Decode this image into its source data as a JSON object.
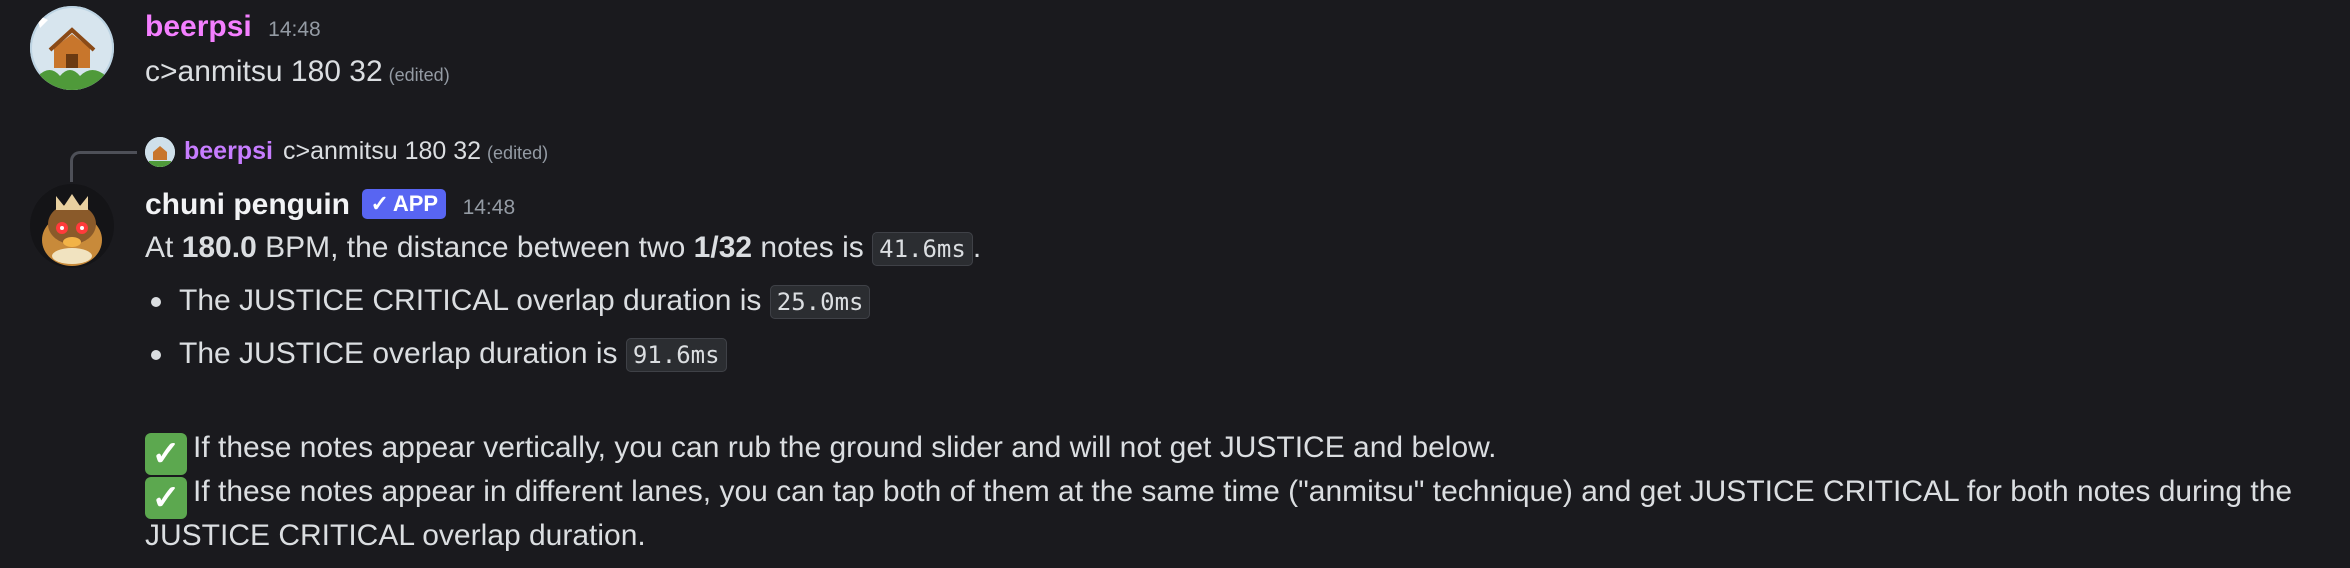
{
  "message1": {
    "username": "beerpsi",
    "username_color": "#f47fff",
    "timestamp": "14:48",
    "content": "c>anmitsu 180 32",
    "edited": "(edited)"
  },
  "reply": {
    "username": "beerpsi",
    "username_color": "#c77dff",
    "content": "c>anmitsu 180 32",
    "edited": "(edited)"
  },
  "message2": {
    "username": "chuni penguin",
    "badge_check": "✓",
    "badge": "APP",
    "timestamp": "14:48",
    "line1": {
      "t1": "At ",
      "bpm": "180.0",
      "t2": " BPM, the distance between two ",
      "division": "1/32",
      "t3": " notes is ",
      "distance": "41.6ms",
      "t4": "."
    },
    "bullets": [
      {
        "text": "The JUSTICE CRITICAL overlap duration is ",
        "value": "25.0ms"
      },
      {
        "text": "The JUSTICE overlap duration is ",
        "value": "91.6ms"
      }
    ],
    "check_glyph": "✓",
    "para1": "If these notes appear vertically, you can rub the ground slider and will not get JUSTICE and below.",
    "para2_line1": "If these notes appear in different lanes, you can tap both of them at the same time (\"anmitsu\" technique) and get JUSTICE CRITICAL for both notes during the",
    "para2_line2": "JUSTICE CRITICAL overlap duration."
  },
  "colors": {
    "background": "#1a1a1e",
    "text": "#dbdee1",
    "muted": "#949ba4",
    "app_badge": "#5865f2",
    "check_emoji": "#5ca84f"
  }
}
